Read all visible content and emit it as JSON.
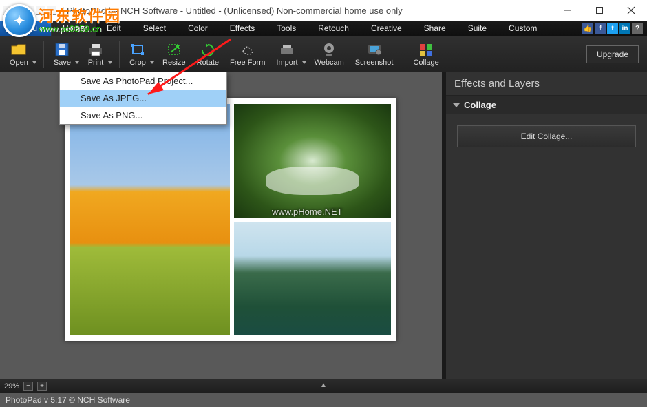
{
  "title": "| PhotoPad by NCH Software - Untitled - (Unlicensed) Non-commercial home use only",
  "menu_button": "Menu",
  "tabs": [
    "Home",
    "Edit",
    "Select",
    "Color",
    "Effects",
    "Tools",
    "Retouch",
    "Creative",
    "Share",
    "Suite",
    "Custom"
  ],
  "active_tab": "Home",
  "toolbar": {
    "open": "Open",
    "save": "Save",
    "print": "Print",
    "crop": "Crop",
    "resize": "Resize",
    "rotate": "Rotate",
    "freeform": "Free Form",
    "import": "Import",
    "webcam": "Webcam",
    "screenshot": "Screenshot",
    "collage": "Collage",
    "upgrade": "Upgrade"
  },
  "save_menu": {
    "project": "Save As PhotoPad Project...",
    "jpeg": "Save As JPEG...",
    "png": "Save As PNG..."
  },
  "panel": {
    "header": "Effects and Layers",
    "section": "Collage",
    "edit_btn": "Edit Collage..."
  },
  "status": {
    "zoom": "29%",
    "caret": "▲"
  },
  "footer": "PhotoPad v 5.17   © NCH Software",
  "watermark_center": "www.pHome.NET",
  "overlay": {
    "cn": "河东软件园",
    "url": "www.pc0359.cn"
  },
  "social_colors": {
    "thumb": "#3b5998",
    "fb": "#3b5998",
    "tw": "#1da1f2",
    "in": "#0077b5",
    "qm": "#666"
  }
}
